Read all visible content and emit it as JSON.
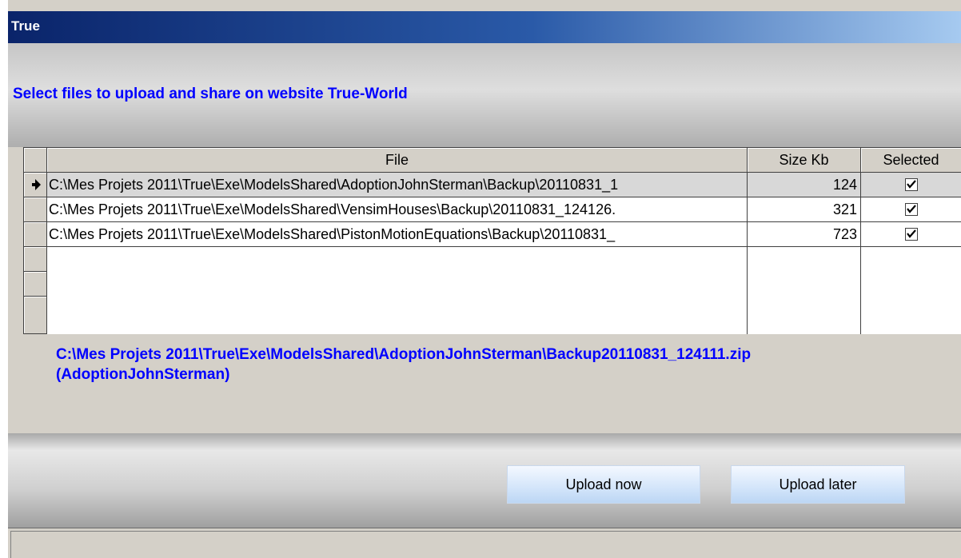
{
  "window": {
    "title": "True"
  },
  "instruction": "Select files to upload and share on website True-World",
  "grid": {
    "columns": [
      "File",
      "Size Kb",
      "Selected"
    ],
    "rows": [
      {
        "file": "C:\\Mes Projets 2011\\True\\Exe\\ModelsShared\\AdoptionJohnSterman\\Backup\\20110831_1",
        "size": "124",
        "selected": true
      },
      {
        "file": "C:\\Mes Projets 2011\\True\\Exe\\ModelsShared\\VensimHouses\\Backup\\20110831_124126.",
        "size": "321",
        "selected": true
      },
      {
        "file": "C:\\Mes Projets 2011\\True\\Exe\\ModelsShared\\PistonMotionEquations\\Backup\\20110831_",
        "size": "723",
        "selected": true
      }
    ],
    "current_row_indicator": "arrow-right-icon"
  },
  "details": {
    "line1": "C:\\Mes Projets 2011\\True\\Exe\\ModelsShared\\AdoptionJohnSterman\\Backup20110831_124111.zip",
    "line2": "(AdoptionJohnSterman)"
  },
  "buttons": {
    "upload_now": "Upload now",
    "upload_later": "Upload later"
  },
  "colors": {
    "title_start": "#0a246a",
    "title_end": "#a6caf0",
    "accent_text": "#0000ff",
    "face": "#d4d0c8"
  }
}
